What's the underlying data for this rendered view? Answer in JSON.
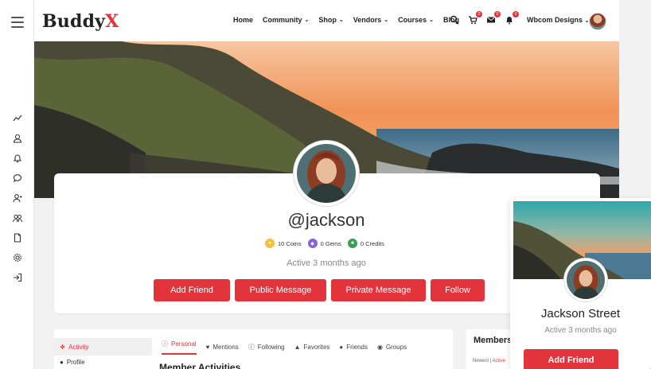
{
  "brand": {
    "name_main": "Buddy",
    "name_accent": "X"
  },
  "nav": [
    {
      "label": "Home",
      "dropdown": false
    },
    {
      "label": "Community",
      "dropdown": true
    },
    {
      "label": "Shop",
      "dropdown": true
    },
    {
      "label": "Vendors",
      "dropdown": true
    },
    {
      "label": "Courses",
      "dropdown": true
    },
    {
      "label": "Blog",
      "dropdown": false
    }
  ],
  "header_icons": {
    "cart_count": "0",
    "messages_count": "0",
    "notifications_count": "0"
  },
  "user_menu": {
    "label": "Wbcom Designs"
  },
  "profile": {
    "username": "@jackson",
    "points": [
      {
        "label": "10 Coins",
        "color": "#f5c03b",
        "icon": "coin-icon"
      },
      {
        "label": "0 Gems",
        "color": "#8a63d2",
        "icon": "gem-icon"
      },
      {
        "label": "0 Credits",
        "color": "#3a9f4f",
        "icon": "credit-icon"
      }
    ],
    "active": "Active 3 months ago",
    "buttons": [
      "Add Friend",
      "Public Message",
      "Private Message",
      "Follow"
    ]
  },
  "side_tabs": {
    "activity": "Activity",
    "profile": "Profile"
  },
  "subtabs": [
    "Personal",
    "Mentions",
    "Following",
    "Favorites",
    "Friends",
    "Groups"
  ],
  "section_title": "Member Activities",
  "members_widget": {
    "title": "Members",
    "filter_newest": "Newest",
    "filter_active": "Active"
  },
  "popup": {
    "name": "Jackson Street",
    "active": "Active 3 months ago",
    "button": "Add Friend"
  },
  "colors": {
    "accent": "#e3343b"
  }
}
